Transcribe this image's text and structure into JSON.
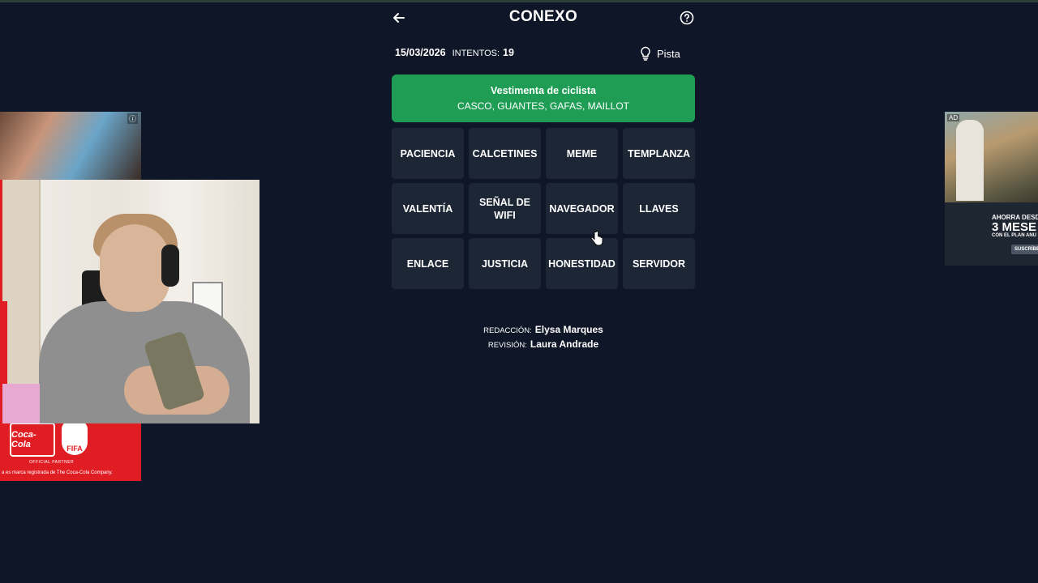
{
  "header": {
    "title": "CONEXO",
    "back_icon": "arrow-left-icon",
    "help_icon": "question-circle-icon"
  },
  "meta": {
    "date": "15/03/2026",
    "attempts_label": "INTENTOS:",
    "attempts_value": "19",
    "hint_label": "Pista",
    "hint_icon": "lightbulb-icon"
  },
  "solved_group": {
    "category": "Vestimenta de ciclista",
    "words": "CASCO, GUANTES, GAFAS, MAILLOT",
    "color": "#1f9d55"
  },
  "tiles": [
    "PACIENCIA",
    "CALCETINES",
    "MEME",
    "TEMPLANZA",
    "VALENTÍA",
    "SEÑAL DE WIFI",
    "NAVEGADOR",
    "LLAVES",
    "ENLACE",
    "JUSTICIA",
    "HONESTIDAD",
    "SERVIDOR"
  ],
  "credits": {
    "editor_label": "REDACCIÓN:",
    "editor_name": "Elysa Marques",
    "reviewer_label": "REVISIÓN:",
    "reviewer_name": "Laura Andrade"
  },
  "ad_left": {
    "info_icon": "ⓘ",
    "brand": "Coca-Cola",
    "fifa": "FIFA",
    "partner": "OFFICIAL PARTNER",
    "footnote": "a es marca registrada de The Coca-Cola Company."
  },
  "ad_right": {
    "tag": "AD",
    "line1": "AHORRA DESD",
    "line2": "3 MESE",
    "line3": "CON EL PLAN ANU",
    "cta": "SUSCRÍBE"
  },
  "colors": {
    "background": "#0f1627",
    "tile": "#1c2635",
    "solved": "#1f9d55"
  }
}
